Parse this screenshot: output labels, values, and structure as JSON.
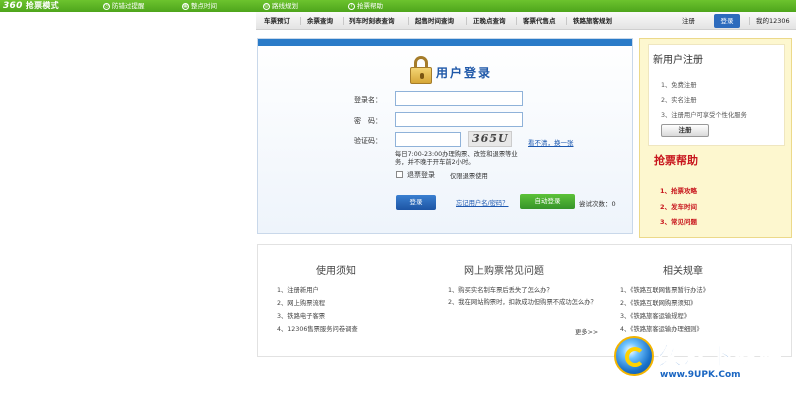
{
  "extension_bar": {
    "logo_num": "360",
    "logo_text": "抢票模式",
    "items": [
      {
        "label": "防错过提醒",
        "icon": "clock-icon"
      },
      {
        "label": "整点时间",
        "icon": "calendar-icon"
      },
      {
        "label": "路线规划",
        "icon": "route-icon"
      },
      {
        "label": "抢票帮助",
        "icon": "help-icon"
      }
    ]
  },
  "nav": {
    "items": [
      "车票预订",
      "余票查询",
      "列车时刻表查询",
      "起售时间查询",
      "正晚点查询",
      "客票代售点",
      "铁路旅客规划"
    ],
    "register": "注册",
    "login": "登录",
    "my_account": "我的12306"
  },
  "login": {
    "title": "用户登录",
    "username_label": "登录名：",
    "password_label": "密　码：",
    "captcha_label": "验证码：",
    "captcha_text": "365U",
    "refresh_link": "看不清，换一张",
    "hint": "每日7:00-23:00办理购票、改签和退票等业务，并不晚于开车前2小时。",
    "refund_label": "退票登录",
    "refund_note": "仅限退票使用",
    "login_button": "登录",
    "forgot_link": "忘记用户名/密码？",
    "auto_login_button": "自动登录",
    "tries_label": "尝试次数：0"
  },
  "register_panel": {
    "title": "新用户注册",
    "steps": [
      "1、免费注册",
      "2、实名注册",
      "3、注册用户可享受个性化服务"
    ],
    "register_button": "注册"
  },
  "help_panel": {
    "title": "抢票帮助",
    "items": [
      "1、抢票攻略",
      "2、发车时间",
      "3、常见问题"
    ]
  },
  "bottom": {
    "notice": {
      "title": "使用须知",
      "items": [
        "1、注册新用户",
        "2、网上购票流程",
        "3、铁路电子客票",
        "4、12306售票服务问卷调查"
      ]
    },
    "faq": {
      "title": "网上购票常见问题",
      "items": [
        "1、购买实名制车票后丢失了怎么办？",
        "2、我在网站购票时，扣款成功但购票不成功怎么办？"
      ],
      "more": "更多>>"
    },
    "rules": {
      "title": "相关规章",
      "items": [
        "1、《铁路互联网售票暂行办法》",
        "2、《铁路互联网购票须知》",
        "3、《铁路旅客运输规程》",
        "4、《铁路旅客运输办理细则》"
      ]
    }
  },
  "watermark": {
    "name": "久友下载站",
    "url": "www.9UPK.Com"
  },
  "colors": {
    "extension_bar": "#4ea51c",
    "nav_active": "#2d6bbd",
    "help_red": "#c8161d",
    "register_bg": "#fdf7cf"
  }
}
